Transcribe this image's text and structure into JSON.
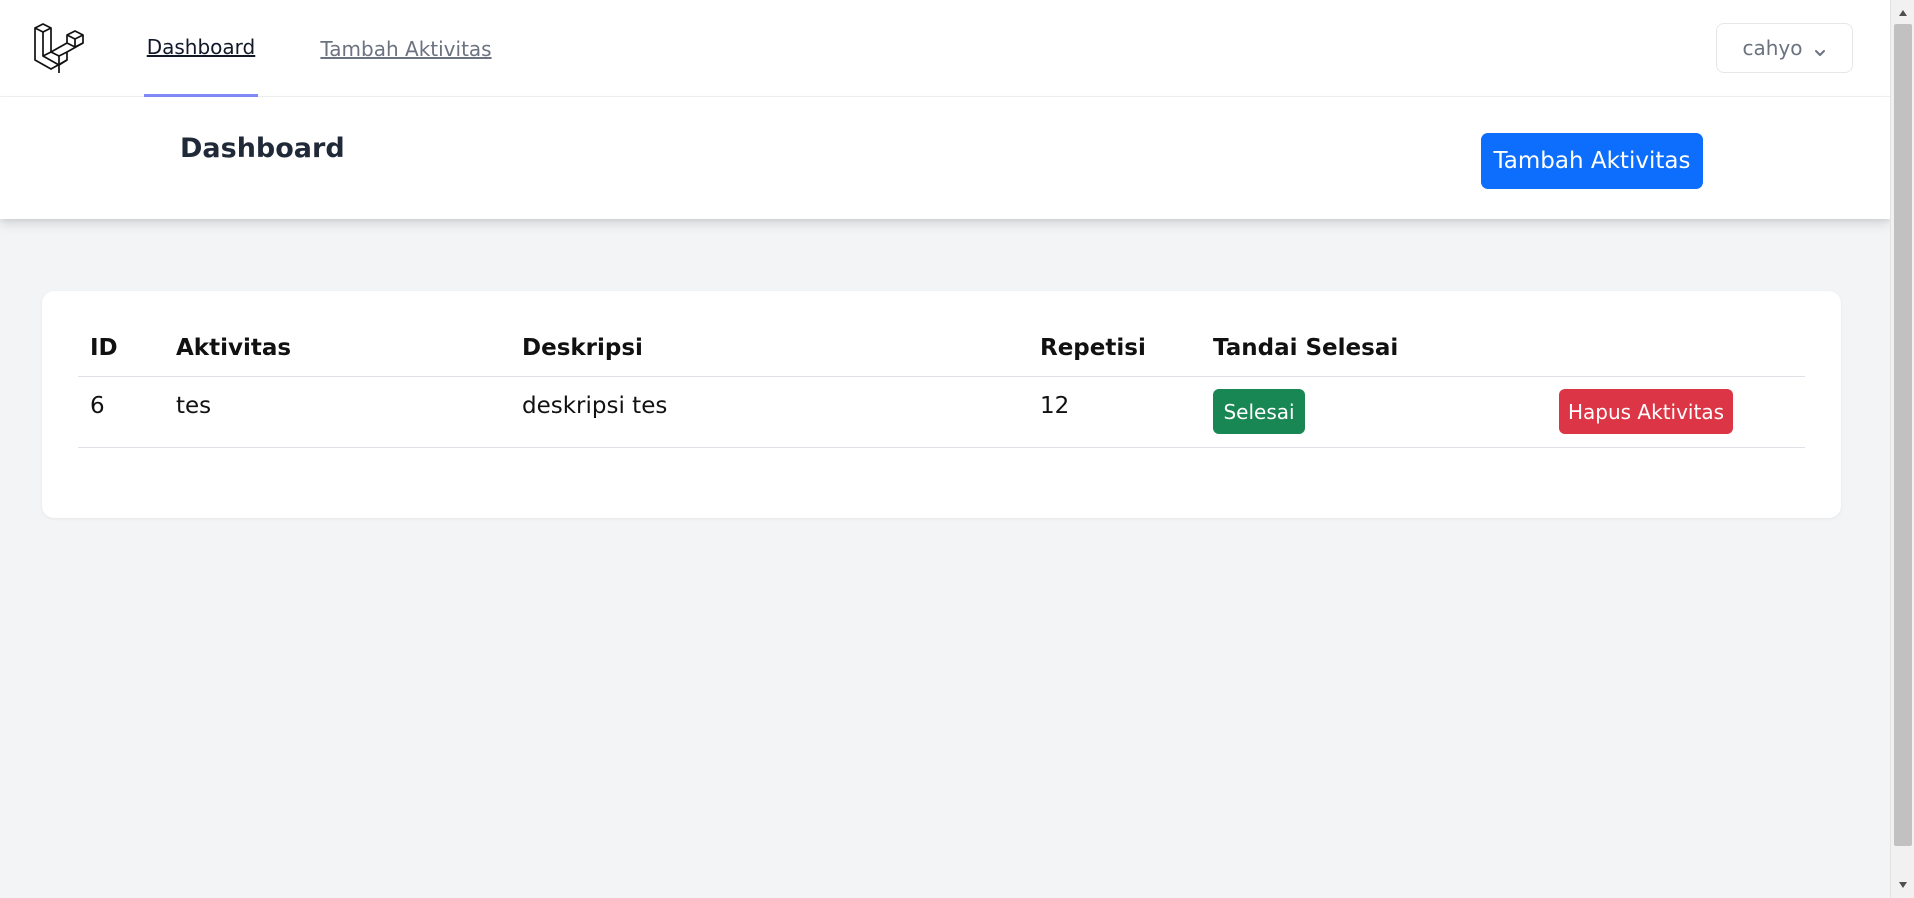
{
  "nav": {
    "logo_icon": "laravel-logo-icon",
    "links": [
      {
        "label": "Dashboard",
        "active": true
      },
      {
        "label": "Tambah Aktivitas",
        "active": false
      }
    ],
    "user": {
      "name": "cahyo",
      "icon": "chevron-down-icon"
    }
  },
  "header": {
    "title": "Dashboard",
    "add_button_label": "Tambah Aktivitas"
  },
  "table": {
    "columns": [
      "ID",
      "Aktivitas",
      "Deskripsi",
      "Repetisi",
      "Tandai Selesai"
    ],
    "rows": [
      {
        "id": "6",
        "aktivitas": "tes",
        "deskripsi": "deskripsi tes",
        "repetisi": "12",
        "done_label": "Selesai",
        "delete_label": "Hapus Aktivitas"
      }
    ]
  },
  "colors": {
    "primary": "#0d6efd",
    "success": "#198754",
    "danger": "#dc3545",
    "active_tab_indicator": "#818cf8",
    "background": "#f3f4f6"
  }
}
